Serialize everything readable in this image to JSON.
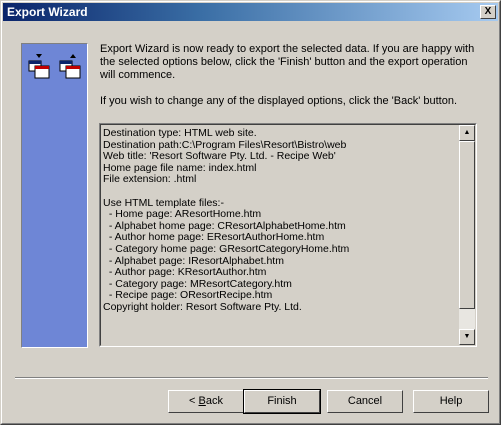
{
  "window": {
    "title": "Export Wizard",
    "close_label": "X"
  },
  "intro": {
    "paragraph1": "Export Wizard is now ready to export the selected data.  If you are happy with the selected options below, click the 'Finish' button and the export operation will commence.",
    "paragraph2": "If you wish to change any of the displayed options, click the 'Back' button."
  },
  "summary_lines": [
    "Destination type: HTML web site.",
    "Destination path:C:\\Program Files\\Resort\\Bistro\\web",
    "Web title: 'Resort Software Pty. Ltd. - Recipe Web'",
    "Home page file name: index.html",
    "File extension: .html",
    "",
    "Use HTML template files:-",
    "  - Home page: AResortHome.htm",
    "  - Alphabet home page: CResortAlphabetHome.htm",
    "  - Author home page: EResortAuthorHome.htm",
    "  - Category home page: GResortCategoryHome.htm",
    "  - Alphabet page: IResortAlphabet.htm",
    "  - Author page: KResortAuthor.htm",
    "  - Category page: MResortCategory.htm",
    "  - Recipe page: OResortRecipe.htm",
    "Copyright holder: Resort Software Pty. Ltd."
  ],
  "scrollbar": {
    "up_arrow": "▲",
    "down_arrow": "▼"
  },
  "buttons": {
    "back_prefix": "< ",
    "back_underlined": "B",
    "back_rest": "ack",
    "finish": "Finish",
    "cancel": "Cancel",
    "help": "Help"
  },
  "colors": {
    "side_panel": "#6e86d6",
    "title_start": "#0a246a",
    "title_end": "#a6caf0"
  },
  "icons": [
    "export-documents-icon"
  ]
}
